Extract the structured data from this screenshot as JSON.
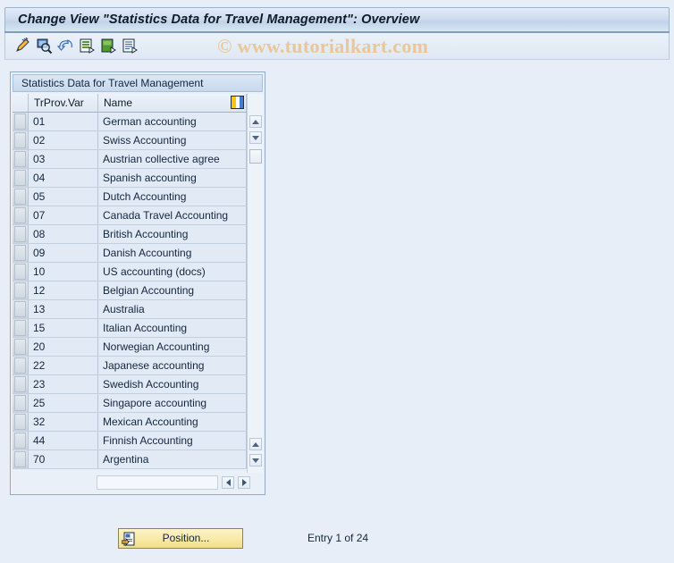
{
  "window": {
    "title": "Change View \"Statistics Data for Travel Management\": Overview"
  },
  "toolbar": {
    "buttons": [
      {
        "name": "display-change-icon",
        "label": "Display/Change"
      },
      {
        "name": "check-entries-icon",
        "label": "Check entries"
      },
      {
        "name": "undo-icon",
        "label": "Undo change"
      },
      {
        "name": "new-entries-icon",
        "label": "New Entries"
      },
      {
        "name": "copy-as-icon",
        "label": "Copy As..."
      },
      {
        "name": "details-icon",
        "label": "Details"
      }
    ]
  },
  "watermark": {
    "text": "© www.tutorialkart.com"
  },
  "panel": {
    "caption": "Statistics Data for Travel Management",
    "config_icon": "table-settings-icon"
  },
  "table": {
    "columns": [
      {
        "key": "trprov_var",
        "label": "TrProv.Var"
      },
      {
        "key": "name",
        "label": "Name"
      }
    ],
    "rows": [
      {
        "trprov_var": "01",
        "name": "German accounting"
      },
      {
        "trprov_var": "02",
        "name": "Swiss Accounting"
      },
      {
        "trprov_var": "03",
        "name": "Austrian collective agree"
      },
      {
        "trprov_var": "04",
        "name": "Spanish accounting"
      },
      {
        "trprov_var": "05",
        "name": "Dutch Accounting"
      },
      {
        "trprov_var": "07",
        "name": "Canada Travel Accounting"
      },
      {
        "trprov_var": "08",
        "name": "British Accounting"
      },
      {
        "trprov_var": "09",
        "name": "Danish Accounting"
      },
      {
        "trprov_var": "10",
        "name": "US accounting (docs)"
      },
      {
        "trprov_var": "12",
        "name": "Belgian Accounting"
      },
      {
        "trprov_var": "13",
        "name": "Australia"
      },
      {
        "trprov_var": "15",
        "name": "Italian Accounting"
      },
      {
        "trprov_var": "20",
        "name": "Norwegian Accounting"
      },
      {
        "trprov_var": "22",
        "name": "Japanese accounting"
      },
      {
        "trprov_var": "23",
        "name": "Swedish Accounting"
      },
      {
        "trprov_var": "25",
        "name": "Singapore accounting"
      },
      {
        "trprov_var": "32",
        "name": "Mexican Accounting"
      },
      {
        "trprov_var": "44",
        "name": "Finnish Accounting"
      },
      {
        "trprov_var": "70",
        "name": "Argentina"
      }
    ]
  },
  "footer": {
    "position_button": "Position...",
    "entry_status": "Entry 1 of 24"
  },
  "colors": {
    "background": "#e8eef7",
    "title_bar": "#cfdcee",
    "row_cell": "#e2eaf5",
    "button_yellow": "#f8e9a6",
    "watermark": "#eac79a"
  }
}
